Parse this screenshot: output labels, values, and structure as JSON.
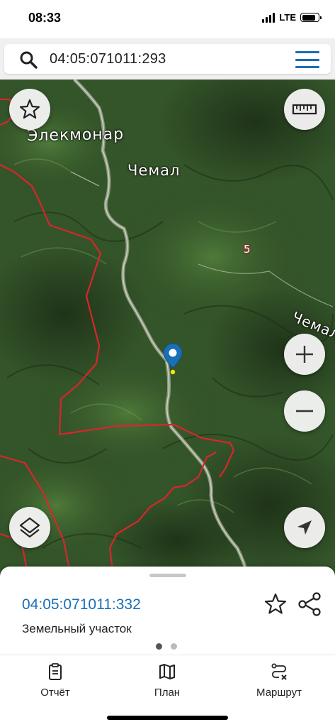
{
  "status_bar": {
    "time": "08:33",
    "network": "LTE",
    "battery_level": 0.85
  },
  "search": {
    "value": "04:05:071011:293"
  },
  "map": {
    "labels": {
      "village_1": "Элекмонар",
      "village_2": "Чемал",
      "number": "5",
      "river": "Чемал"
    },
    "colors": {
      "boundary": "#d8262b",
      "marker": "#1a6fb5",
      "marker_point": "#f5e60a"
    }
  },
  "bottom_sheet": {
    "parcel_id": "04:05:071011:332",
    "parcel_type": "Земельный участок",
    "page_dots": {
      "total": 2,
      "active": 1
    },
    "tabs": [
      {
        "label": "Отчёт",
        "icon": "report-icon"
      },
      {
        "label": "План",
        "icon": "map-plan-icon"
      },
      {
        "label": "Маршрут",
        "icon": "route-icon"
      }
    ]
  },
  "colors": {
    "accent": "#1a6fb5",
    "boundary": "#d8262b"
  }
}
